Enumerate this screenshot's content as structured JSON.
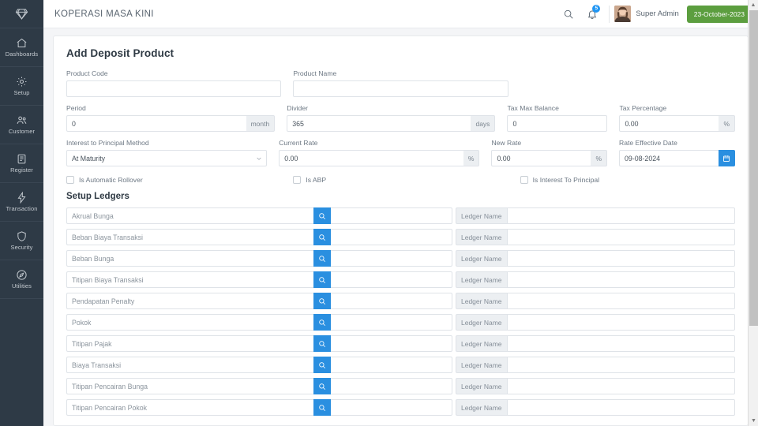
{
  "sidebar": {
    "logo_icon": "diamond-icon",
    "items": [
      {
        "label": "Dashboards",
        "icon": "home-icon"
      },
      {
        "label": "Setup",
        "icon": "gear-icon"
      },
      {
        "label": "Customer",
        "icon": "users-icon"
      },
      {
        "label": "Register",
        "icon": "book-icon"
      },
      {
        "label": "Transaction",
        "icon": "bolt-icon"
      },
      {
        "label": "Security",
        "icon": "shield-icon"
      },
      {
        "label": "Utilities",
        "icon": "compass-icon"
      }
    ]
  },
  "topbar": {
    "app_title": "KOPERASI MASA KINI",
    "search_icon": "search-icon",
    "bell_icon": "bell-icon",
    "notification_count": "5",
    "user_name": "Super Admin",
    "date_label": "23-October-2023",
    "accent_green": "#5c9e3f",
    "accent_blue": "#2a8fe0"
  },
  "page": {
    "title": "Add Deposit Product",
    "fields": {
      "product_code": {
        "label": "Product Code",
        "value": "",
        "placeholder": ""
      },
      "product_name": {
        "label": "Product Name",
        "value": "",
        "placeholder": ""
      },
      "period": {
        "label": "Period",
        "value": "0",
        "addon": "month"
      },
      "divider": {
        "label": "Divider",
        "value": "365",
        "addon": "days"
      },
      "tax_max_balance": {
        "label": "Tax Max Balance",
        "value": "0"
      },
      "tax_percentage": {
        "label": "Tax Percentage",
        "value": "0.00",
        "addon": "%"
      },
      "interest_method": {
        "label": "Interest to Principal Method",
        "value": "At Maturity",
        "options": [
          "At Maturity"
        ]
      },
      "current_rate": {
        "label": "Current Rate",
        "value": "0.00",
        "addon": "%"
      },
      "new_rate": {
        "label": "New Rate",
        "value": "0.00",
        "addon": "%"
      },
      "rate_effective_date": {
        "label": "Rate Effective Date",
        "value": "09-08-2024",
        "addon_icon": "calendar-icon"
      }
    },
    "checkboxes": [
      {
        "label": "Is Automatic Rollover",
        "checked": false
      },
      {
        "label": "Is ABP",
        "checked": false
      },
      {
        "label": "Is Interest To Principal",
        "checked": false
      }
    ],
    "ledgers": {
      "section_title": "Setup Ledgers",
      "search_icon": "search-icon",
      "name_prefix_label": "Ledger Name",
      "rows": [
        {
          "name": "Akrual Bunga",
          "code": "",
          "ledger_name": ""
        },
        {
          "name": "Beban Biaya Transaksi",
          "code": "",
          "ledger_name": ""
        },
        {
          "name": "Beban Bunga",
          "code": "",
          "ledger_name": ""
        },
        {
          "name": "Titipan Biaya Transaksi",
          "code": "",
          "ledger_name": ""
        },
        {
          "name": "Pendapatan Penalty",
          "code": "",
          "ledger_name": ""
        },
        {
          "name": "Pokok",
          "code": "",
          "ledger_name": ""
        },
        {
          "name": "Titipan Pajak",
          "code": "",
          "ledger_name": ""
        },
        {
          "name": "Biaya Transaksi",
          "code": "",
          "ledger_name": ""
        },
        {
          "name": "Titipan Pencairan Bunga",
          "code": "",
          "ledger_name": ""
        },
        {
          "name": "Titipan Pencairan Pokok",
          "code": "",
          "ledger_name": ""
        }
      ]
    }
  }
}
